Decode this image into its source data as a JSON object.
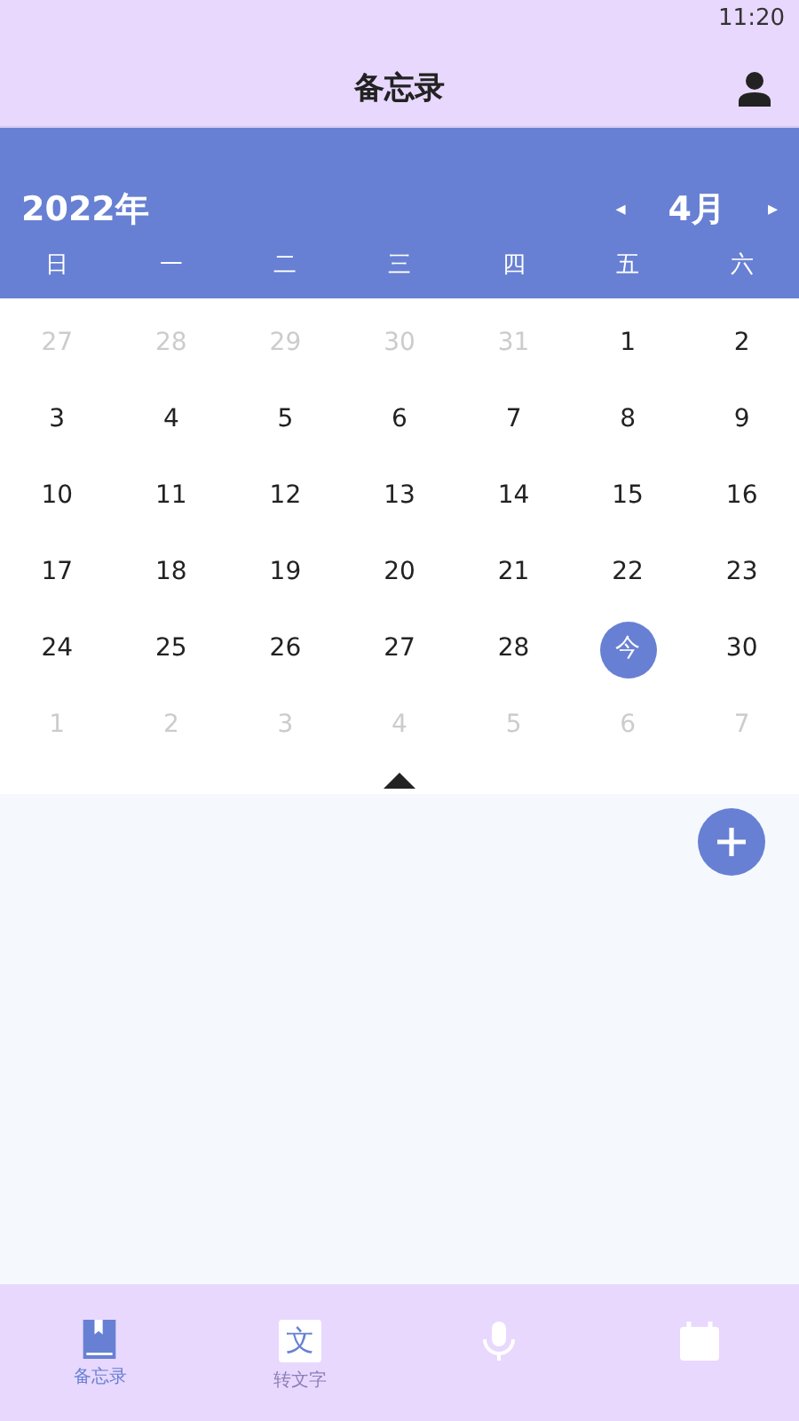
{
  "status_bar": {
    "time": "11:20"
  },
  "header": {
    "title": "备忘录"
  },
  "calendar": {
    "year": "2022年",
    "month": "4月",
    "prev": "◂",
    "next": "▸",
    "weekdays": [
      "日",
      "一",
      "二",
      "三",
      "四",
      "五",
      "六"
    ],
    "weeks": [
      [
        {
          "text": "27",
          "muted": true,
          "selected": false
        },
        {
          "text": "28",
          "muted": true,
          "selected": false
        },
        {
          "text": "29",
          "muted": true,
          "selected": false
        },
        {
          "text": "30",
          "muted": true,
          "selected": false
        },
        {
          "text": "31",
          "muted": true,
          "selected": false
        },
        {
          "text": "1",
          "muted": false,
          "selected": false
        },
        {
          "text": "2",
          "muted": false,
          "selected": false
        }
      ],
      [
        {
          "text": "3",
          "muted": false,
          "selected": false
        },
        {
          "text": "4",
          "muted": false,
          "selected": false
        },
        {
          "text": "5",
          "muted": false,
          "selected": false
        },
        {
          "text": "6",
          "muted": false,
          "selected": false
        },
        {
          "text": "7",
          "muted": false,
          "selected": false
        },
        {
          "text": "8",
          "muted": false,
          "selected": false
        },
        {
          "text": "9",
          "muted": false,
          "selected": false
        }
      ],
      [
        {
          "text": "10",
          "muted": false,
          "selected": false
        },
        {
          "text": "11",
          "muted": false,
          "selected": false
        },
        {
          "text": "12",
          "muted": false,
          "selected": false
        },
        {
          "text": "13",
          "muted": false,
          "selected": false
        },
        {
          "text": "14",
          "muted": false,
          "selected": false
        },
        {
          "text": "15",
          "muted": false,
          "selected": false
        },
        {
          "text": "16",
          "muted": false,
          "selected": false
        }
      ],
      [
        {
          "text": "17",
          "muted": false,
          "selected": false
        },
        {
          "text": "18",
          "muted": false,
          "selected": false
        },
        {
          "text": "19",
          "muted": false,
          "selected": false
        },
        {
          "text": "20",
          "muted": false,
          "selected": false
        },
        {
          "text": "21",
          "muted": false,
          "selected": false
        },
        {
          "text": "22",
          "muted": false,
          "selected": false
        },
        {
          "text": "23",
          "muted": false,
          "selected": false
        }
      ],
      [
        {
          "text": "24",
          "muted": false,
          "selected": false
        },
        {
          "text": "25",
          "muted": false,
          "selected": false
        },
        {
          "text": "26",
          "muted": false,
          "selected": false
        },
        {
          "text": "27",
          "muted": false,
          "selected": false
        },
        {
          "text": "28",
          "muted": false,
          "selected": false
        },
        {
          "text": "今",
          "muted": false,
          "selected": true
        },
        {
          "text": "30",
          "muted": false,
          "selected": false
        }
      ],
      [
        {
          "text": "1",
          "muted": true,
          "selected": false
        },
        {
          "text": "2",
          "muted": true,
          "selected": false
        },
        {
          "text": "3",
          "muted": true,
          "selected": false
        },
        {
          "text": "4",
          "muted": true,
          "selected": false
        },
        {
          "text": "5",
          "muted": true,
          "selected": false
        },
        {
          "text": "6",
          "muted": true,
          "selected": false
        },
        {
          "text": "7",
          "muted": true,
          "selected": false
        }
      ]
    ]
  },
  "bottom_nav": [
    {
      "kind": "book",
      "label": "备忘录",
      "selected": true
    },
    {
      "kind": "text",
      "label": "转文字",
      "glyph": "文",
      "selected": false
    },
    {
      "kind": "mic",
      "selected": false
    },
    {
      "kind": "calendar",
      "selected": false
    }
  ]
}
